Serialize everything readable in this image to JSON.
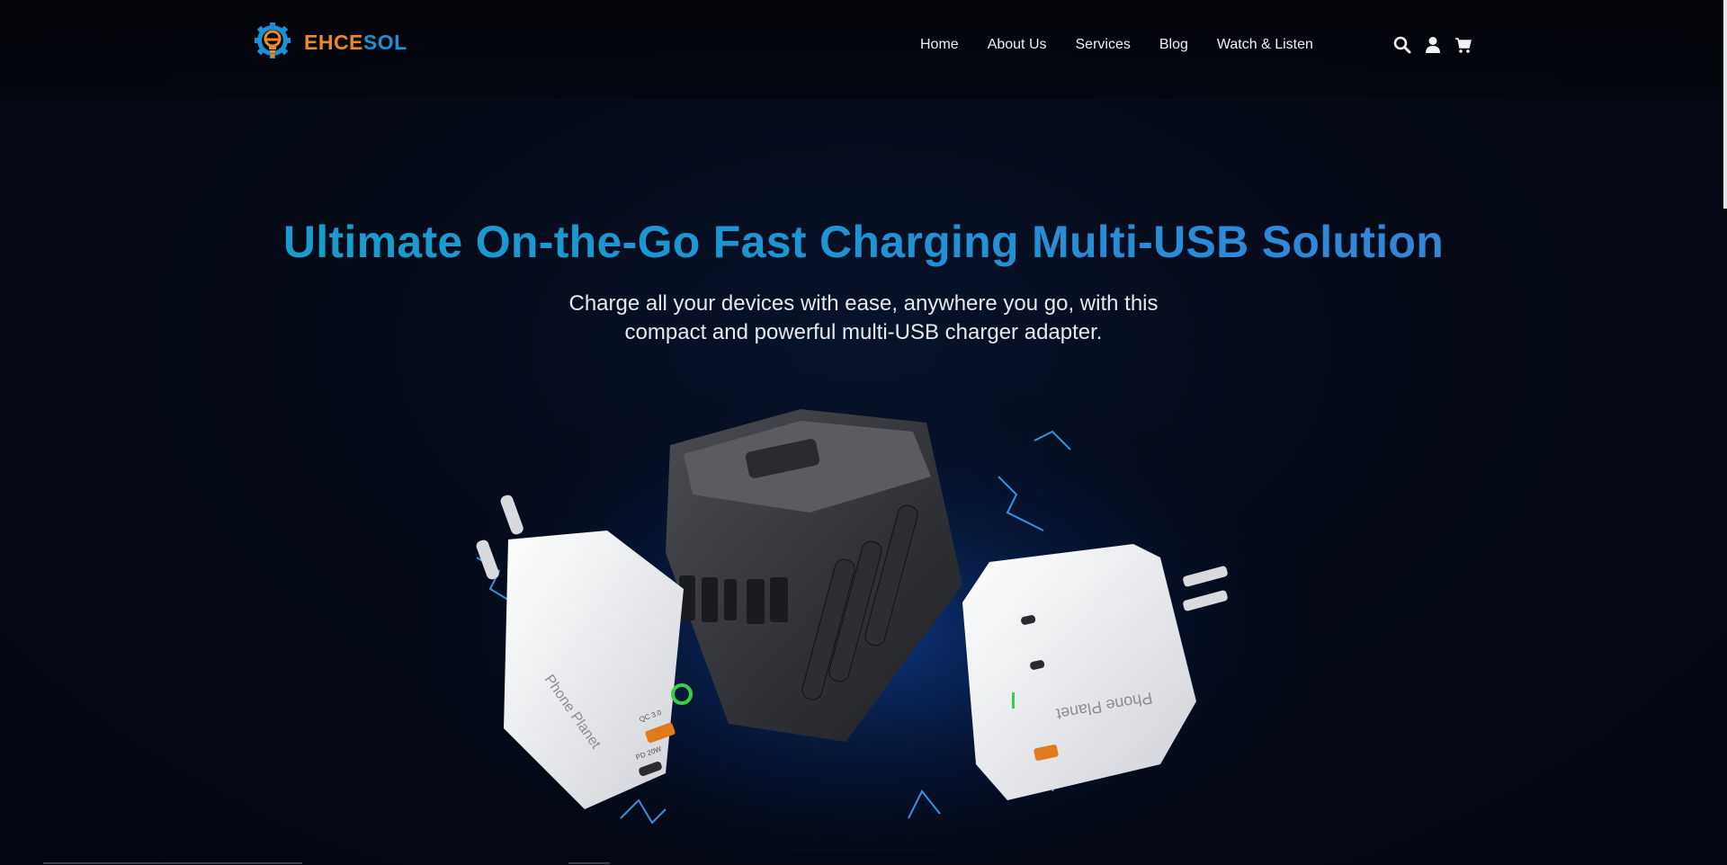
{
  "brand": {
    "name_part1": "EHCE",
    "name_part2": "SOL",
    "logo_icon": "gear-bulb-icon",
    "accent_orange": "#ea8a20",
    "accent_blue": "#1d8fd6"
  },
  "nav": {
    "items": [
      {
        "label": "Home"
      },
      {
        "label": "About Us"
      },
      {
        "label": "Services"
      },
      {
        "label": "Blog"
      },
      {
        "label": "Watch & Listen"
      }
    ]
  },
  "header_icons": [
    "search-icon",
    "user-icon",
    "cart-icon"
  ],
  "hero": {
    "title": "Ultimate On-the-Go Fast Charging Multi-USB Solution",
    "subtitle_line1": "Charge all your devices with ease, anywhere you go, with this",
    "subtitle_line2": "compact and powerful multi-USB charger adapter.",
    "title_gradient": [
      "#14a2c9",
      "#3b7fdd"
    ]
  },
  "product_image": {
    "brand_label": "Phone Planet",
    "port_labels": [
      "QC 3.0",
      "PD 20W"
    ]
  }
}
